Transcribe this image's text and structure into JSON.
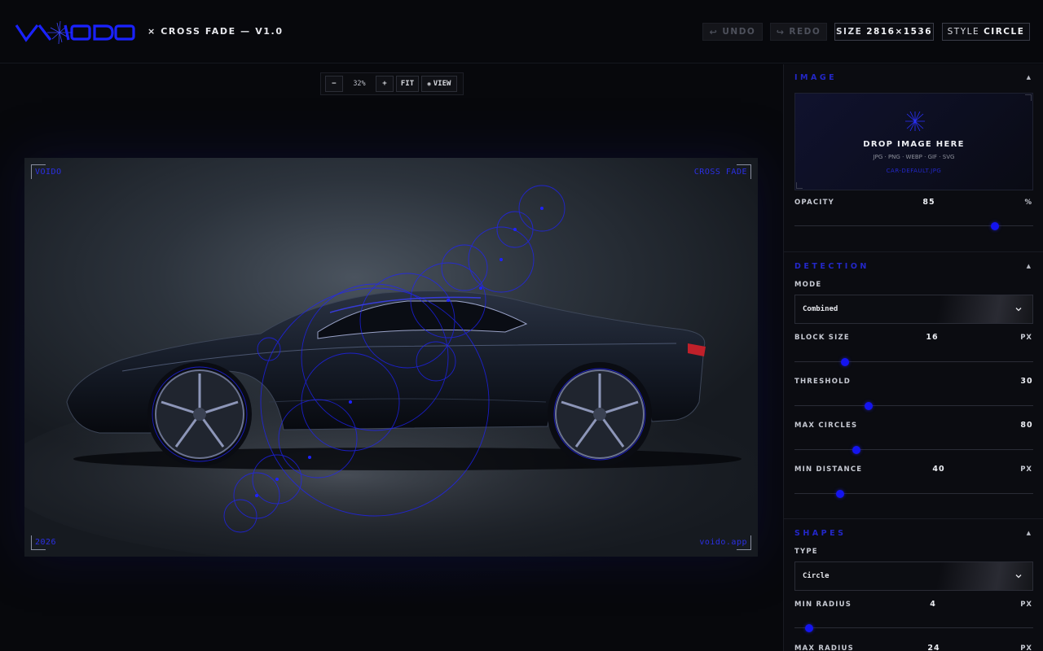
{
  "header": {
    "app_title": "× CROSS FADE — V1.0",
    "undo_label": "UNDO",
    "redo_label": "REDO",
    "size_label": "SIZE",
    "size_value": "2816×1536",
    "style_label": "STYLE",
    "style_value": "CIRCLE"
  },
  "zoom": {
    "minus": "−",
    "level": "32%",
    "plus": "+",
    "fit": "FIT",
    "view": "VIEW"
  },
  "canvas": {
    "top_left": "VOIDO",
    "top_right": "CROSS FADE",
    "bottom_left": "2026",
    "bottom_right": "voido.app"
  },
  "panel": {
    "image": {
      "title": "IMAGE",
      "drop_title": "DROP IMAGE HERE",
      "formats": "JPG · PNG · WEBP · GIF · SVG",
      "filename": "CAR-DEFAULT.JPG",
      "opacity": {
        "label": "OPACITY",
        "value": 85,
        "unit": "%",
        "fraction": 0.84
      }
    },
    "detection": {
      "title": "DETECTION",
      "mode_label": "MODE",
      "mode_value": "Combined",
      "block_size": {
        "label": "BLOCK SIZE",
        "value": 16,
        "unit": "PX",
        "fraction": 0.21
      },
      "threshold": {
        "label": "THRESHOLD",
        "value": 30,
        "unit": "",
        "fraction": 0.31
      },
      "max_circles": {
        "label": "MAX CIRCLES",
        "value": 80,
        "unit": "",
        "fraction": 0.26
      },
      "min_distance": {
        "label": "MIN DISTANCE",
        "value": 40,
        "unit": "PX",
        "fraction": 0.19
      }
    },
    "shapes": {
      "title": "SHAPES",
      "type_label": "TYPE",
      "type_value": "Circle",
      "min_radius": {
        "label": "MIN RADIUS",
        "value": 4,
        "unit": "PX",
        "fraction": 0.06
      },
      "max_radius": {
        "label": "MAX RADIUS",
        "value": 24,
        "unit": "PX"
      }
    }
  },
  "colors": {
    "accent": "#1414f0",
    "background": "#07080c",
    "panel": "#0b0c11"
  }
}
